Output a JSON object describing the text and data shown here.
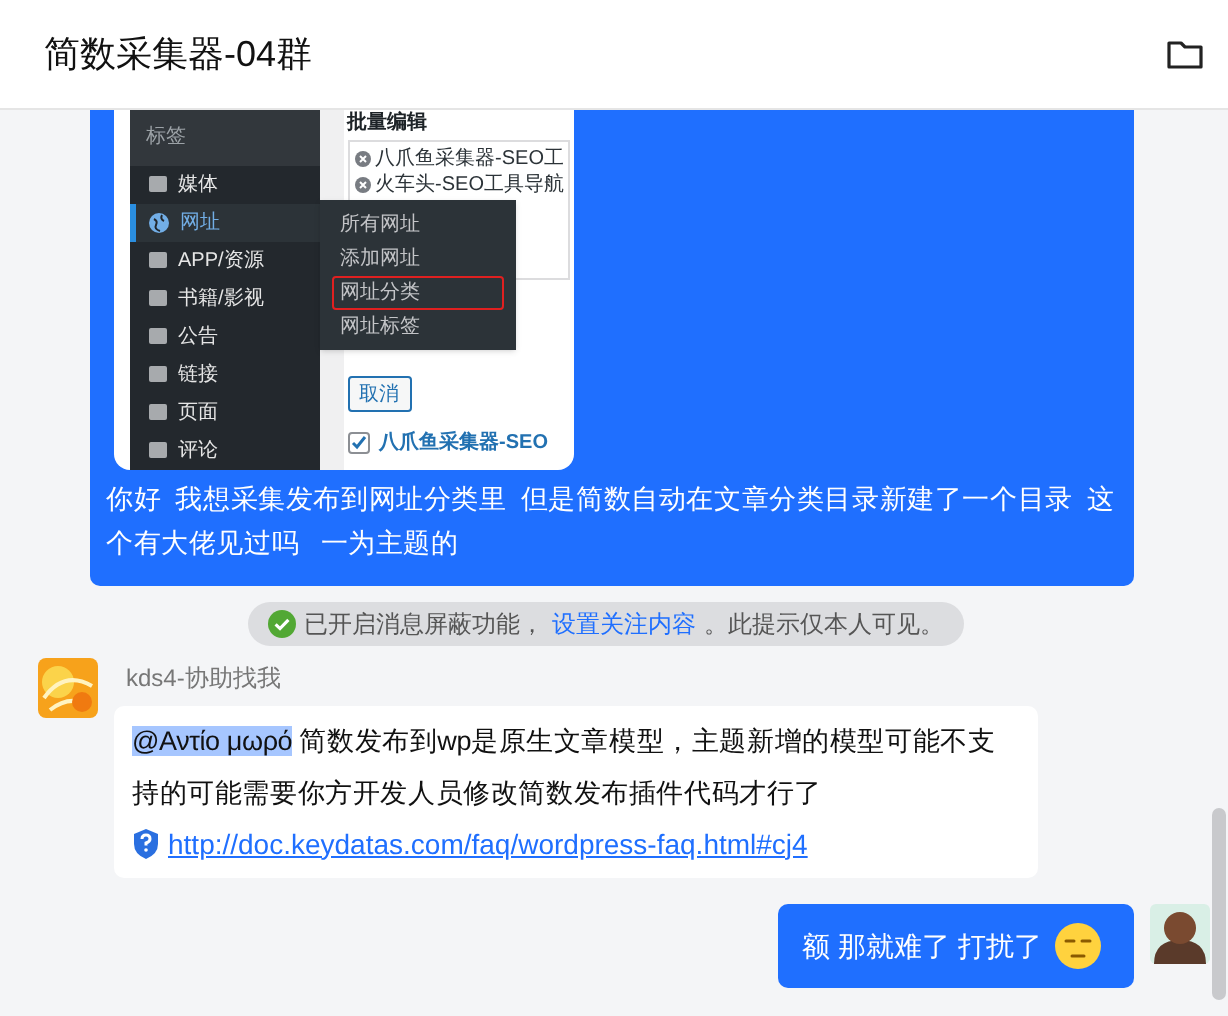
{
  "header": {
    "title": "简数采集器-04群"
  },
  "messages": [
    {
      "kind": "incoming_image",
      "screenshot": {
        "sidebar_header": "标签",
        "sidebar_items": [
          {
            "label": "媒体",
            "selected": false
          },
          {
            "label": "网址",
            "selected": true
          },
          {
            "label": "APP/资源",
            "selected": false
          },
          {
            "label": "书籍/影视",
            "selected": false
          },
          {
            "label": "公告",
            "selected": false
          },
          {
            "label": "链接",
            "selected": false
          },
          {
            "label": "页面",
            "selected": false
          },
          {
            "label": "评论",
            "selected": false
          }
        ],
        "flyout_items": [
          {
            "label": "所有网址",
            "highlighted": false
          },
          {
            "label": "添加网址",
            "highlighted": false
          },
          {
            "label": "网址分类",
            "highlighted": true
          },
          {
            "label": "网址标签",
            "highlighted": false
          }
        ],
        "panel_title": "批量编辑",
        "panel_items": [
          "八爪鱼采集器-SEO工",
          "火车头-SEO工具导航"
        ],
        "cancel_button": "取消",
        "checkbox_row": {
          "label": "八爪鱼采集器-SEO",
          "checked": true
        }
      },
      "text": "你好  我想采集发布到网址分类里  但是简数自动在文章分类目录新建了一个目录  这个有大佬见过吗   一为主题的"
    },
    {
      "kind": "notice",
      "text_before": "已开启消息屏蔽功能，",
      "link": "设置关注内容",
      "text_after": "。此提示仅本人可见。"
    },
    {
      "kind": "incoming",
      "sender": "kds4-协助找我",
      "mention": "@Αντίο μωρό",
      "text": " 简数发布到wp是原生文章模型，主题新增的模型可能不支持的可能需要你方开发人员修改简数发布插件代码才行了",
      "link": "http://doc.keydatas.com/faq/wordpress-faq.html#cj4"
    },
    {
      "kind": "outgoing",
      "text": "额 那就难了 打扰了"
    }
  ]
}
